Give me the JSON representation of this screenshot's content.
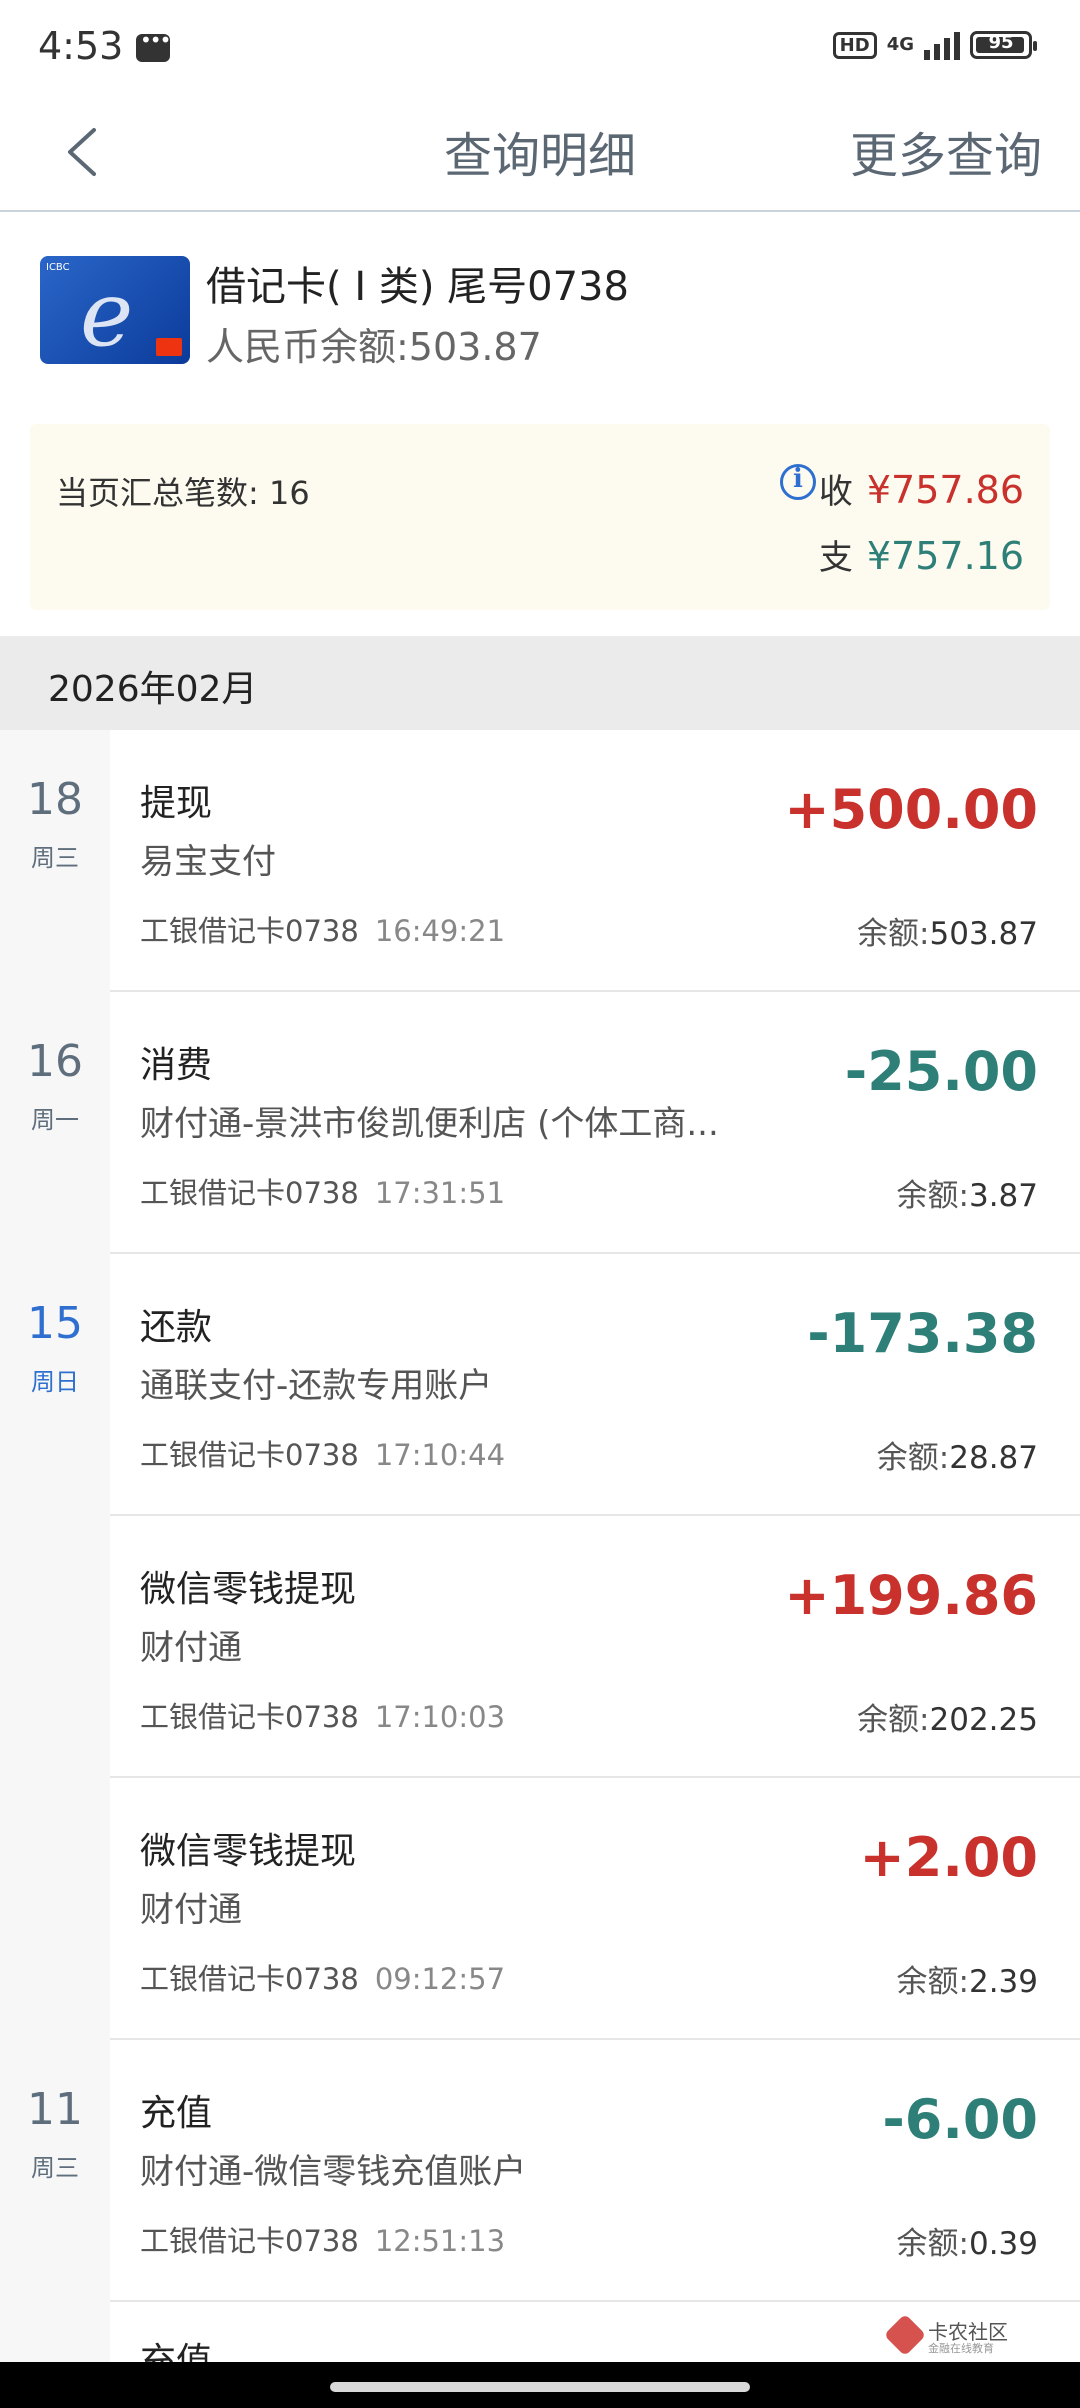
{
  "status": {
    "time": "4:53",
    "hd": "HD",
    "network": "4G",
    "battery": "95",
    "battery_level": 0.95
  },
  "nav": {
    "title": "查询明细",
    "more": "更多查询"
  },
  "card": {
    "name": "借记卡( Ⅰ 类) 尾号0738",
    "balance": "人民币余额:503.87"
  },
  "summary": {
    "count_text": "当页汇总笔数: 16",
    "income_label": "收",
    "income": "¥757.86",
    "expense_label": "支",
    "expense": "¥757.16"
  },
  "month": "2026年02月",
  "transactions": [
    {
      "day": "18",
      "week": "周三",
      "type": "提现",
      "desc": "易宝支付",
      "card": "工银借记卡0738",
      "time": "16:49:21",
      "amount": "+500.00",
      "balance_label": "余额:",
      "balance": "503.87",
      "direction": "in"
    },
    {
      "day": "16",
      "week": "周一",
      "type": "消费",
      "desc": "财付通-景洪市俊凯便利店 (个体工商...",
      "card": "工银借记卡0738",
      "time": "17:31:51",
      "amount": "-25.00",
      "balance_label": "余额:",
      "balance": "3.87",
      "direction": "out"
    },
    {
      "day": "15",
      "week": "周日",
      "type": "还款",
      "desc": "通联支付-还款专用账户",
      "card": "工银借记卡0738",
      "time": "17:10:44",
      "amount": "-173.38",
      "balance_label": "余额:",
      "balance": "28.87",
      "direction": "out"
    },
    {
      "day": "",
      "week": "",
      "type": "微信零钱提现",
      "desc": "财付通",
      "card": "工银借记卡0738",
      "time": "17:10:03",
      "amount": "+199.86",
      "balance_label": "余额:",
      "balance": "202.25",
      "direction": "in"
    },
    {
      "day": "",
      "week": "",
      "type": "微信零钱提现",
      "desc": "财付通",
      "card": "工银借记卡0738",
      "time": "09:12:57",
      "amount": "+2.00",
      "balance_label": "余额:",
      "balance": "2.39",
      "direction": "in"
    },
    {
      "day": "11",
      "week": "周三",
      "type": "充值",
      "desc": "财付通-微信零钱充值账户",
      "card": "工银借记卡0738",
      "time": "12:51:13",
      "amount": "-6.00",
      "balance_label": "余额:",
      "balance": "0.39",
      "direction": "out"
    }
  ],
  "partial_row": {
    "type": "充值"
  },
  "watermark": {
    "main": "卡农社区",
    "sub": "金融在线教育"
  },
  "colors": {
    "income": "#c8312c",
    "expense": "#2e7f77",
    "today": "#2f6fd0",
    "nav_text": "#5b6874"
  }
}
